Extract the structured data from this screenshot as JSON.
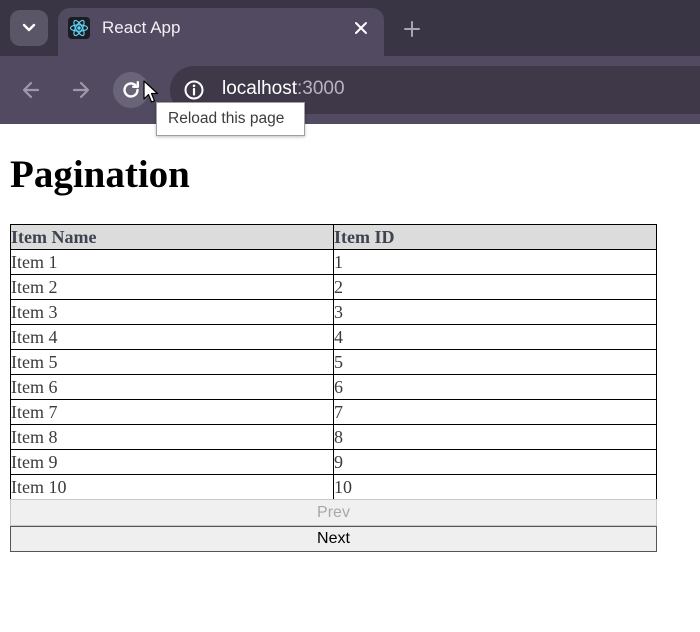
{
  "browser": {
    "tab": {
      "title": "React App",
      "favicon": "react-logo-icon"
    },
    "url": {
      "host": "localhost",
      "port": ":3000"
    },
    "reload_tooltip": "Reload this page",
    "colors": {
      "frame": "#3a3545",
      "toolbar": "#514a60",
      "omnibox": "#3e3849"
    }
  },
  "page": {
    "title": "Pagination",
    "table": {
      "headers": [
        "Item Name",
        "Item ID"
      ],
      "rows": [
        [
          "Item 1",
          "1"
        ],
        [
          "Item 2",
          "2"
        ],
        [
          "Item 3",
          "3"
        ],
        [
          "Item 4",
          "4"
        ],
        [
          "Item 5",
          "5"
        ],
        [
          "Item 6",
          "6"
        ],
        [
          "Item 7",
          "7"
        ],
        [
          "Item 8",
          "8"
        ],
        [
          "Item 9",
          "9"
        ],
        [
          "Item 10",
          "10"
        ]
      ]
    },
    "pagination": {
      "prev_label": "Prev",
      "prev_disabled": true,
      "next_label": "Next"
    }
  }
}
